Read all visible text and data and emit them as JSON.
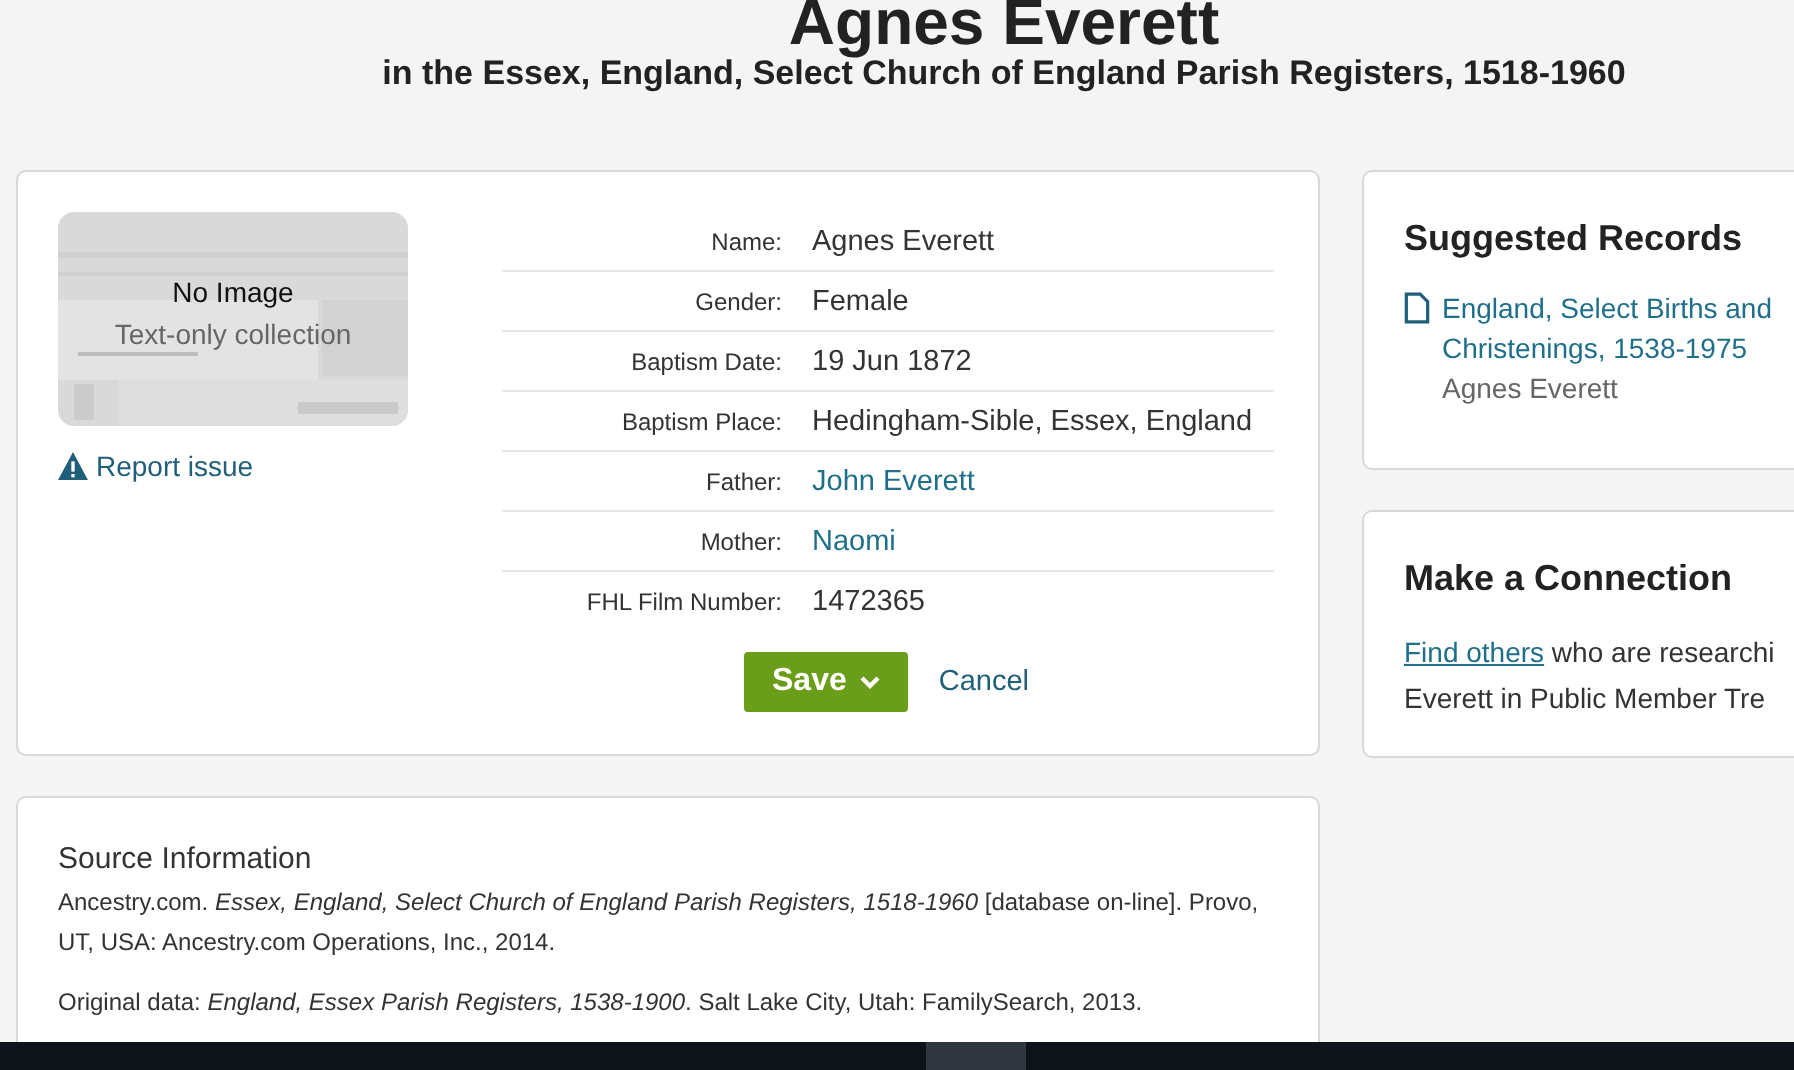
{
  "header": {
    "title": "Agnes Everett",
    "subtitle": "in the Essex, England, Select Church of England Parish Registers, 1518-1960"
  },
  "record": {
    "image": {
      "title": "No Image",
      "note": "Text-only collection"
    },
    "report": "Report issue",
    "fields": [
      {
        "label": "Name:",
        "value": "Agnes Everett",
        "kind": "text"
      },
      {
        "label": "Gender:",
        "value": "Female",
        "kind": "text"
      },
      {
        "label": "Baptism Date:",
        "value": "19 Jun 1872",
        "kind": "text"
      },
      {
        "label": "Baptism Place:",
        "value": "Hedingham-Sible, Essex, England",
        "kind": "text"
      },
      {
        "label": "Father:",
        "value": "John Everett",
        "kind": "link"
      },
      {
        "label": "Mother:",
        "value": "Naomi",
        "kind": "link"
      },
      {
        "label": "FHL Film Number:",
        "value": "1472365",
        "kind": "text"
      }
    ],
    "buttons": {
      "save": "Save",
      "cancel": "Cancel"
    }
  },
  "suggested": {
    "title": "Suggested Records",
    "items": [
      {
        "link": "England, Select Births and Christenings, 1538-1975",
        "name": "Agnes Everett"
      }
    ]
  },
  "connection": {
    "title": "Make a Connection",
    "link": "Find others",
    "text": " who are researchi",
    "line2": "Everett in Public Member Tre"
  },
  "source": {
    "title": "Source Information",
    "paragraphs": [
      "Ancestry.com. *Essex, England, Select Church of England Parish Registers, 1518-1960* [database on-line]. Provo, UT, USA: Ancestry.com Operations, Inc., 2014.",
      "Original data: *England, Essex Parish Registers, 1538-1900*. Salt Lake City, Utah: FamilySearch, 2013."
    ]
  }
}
